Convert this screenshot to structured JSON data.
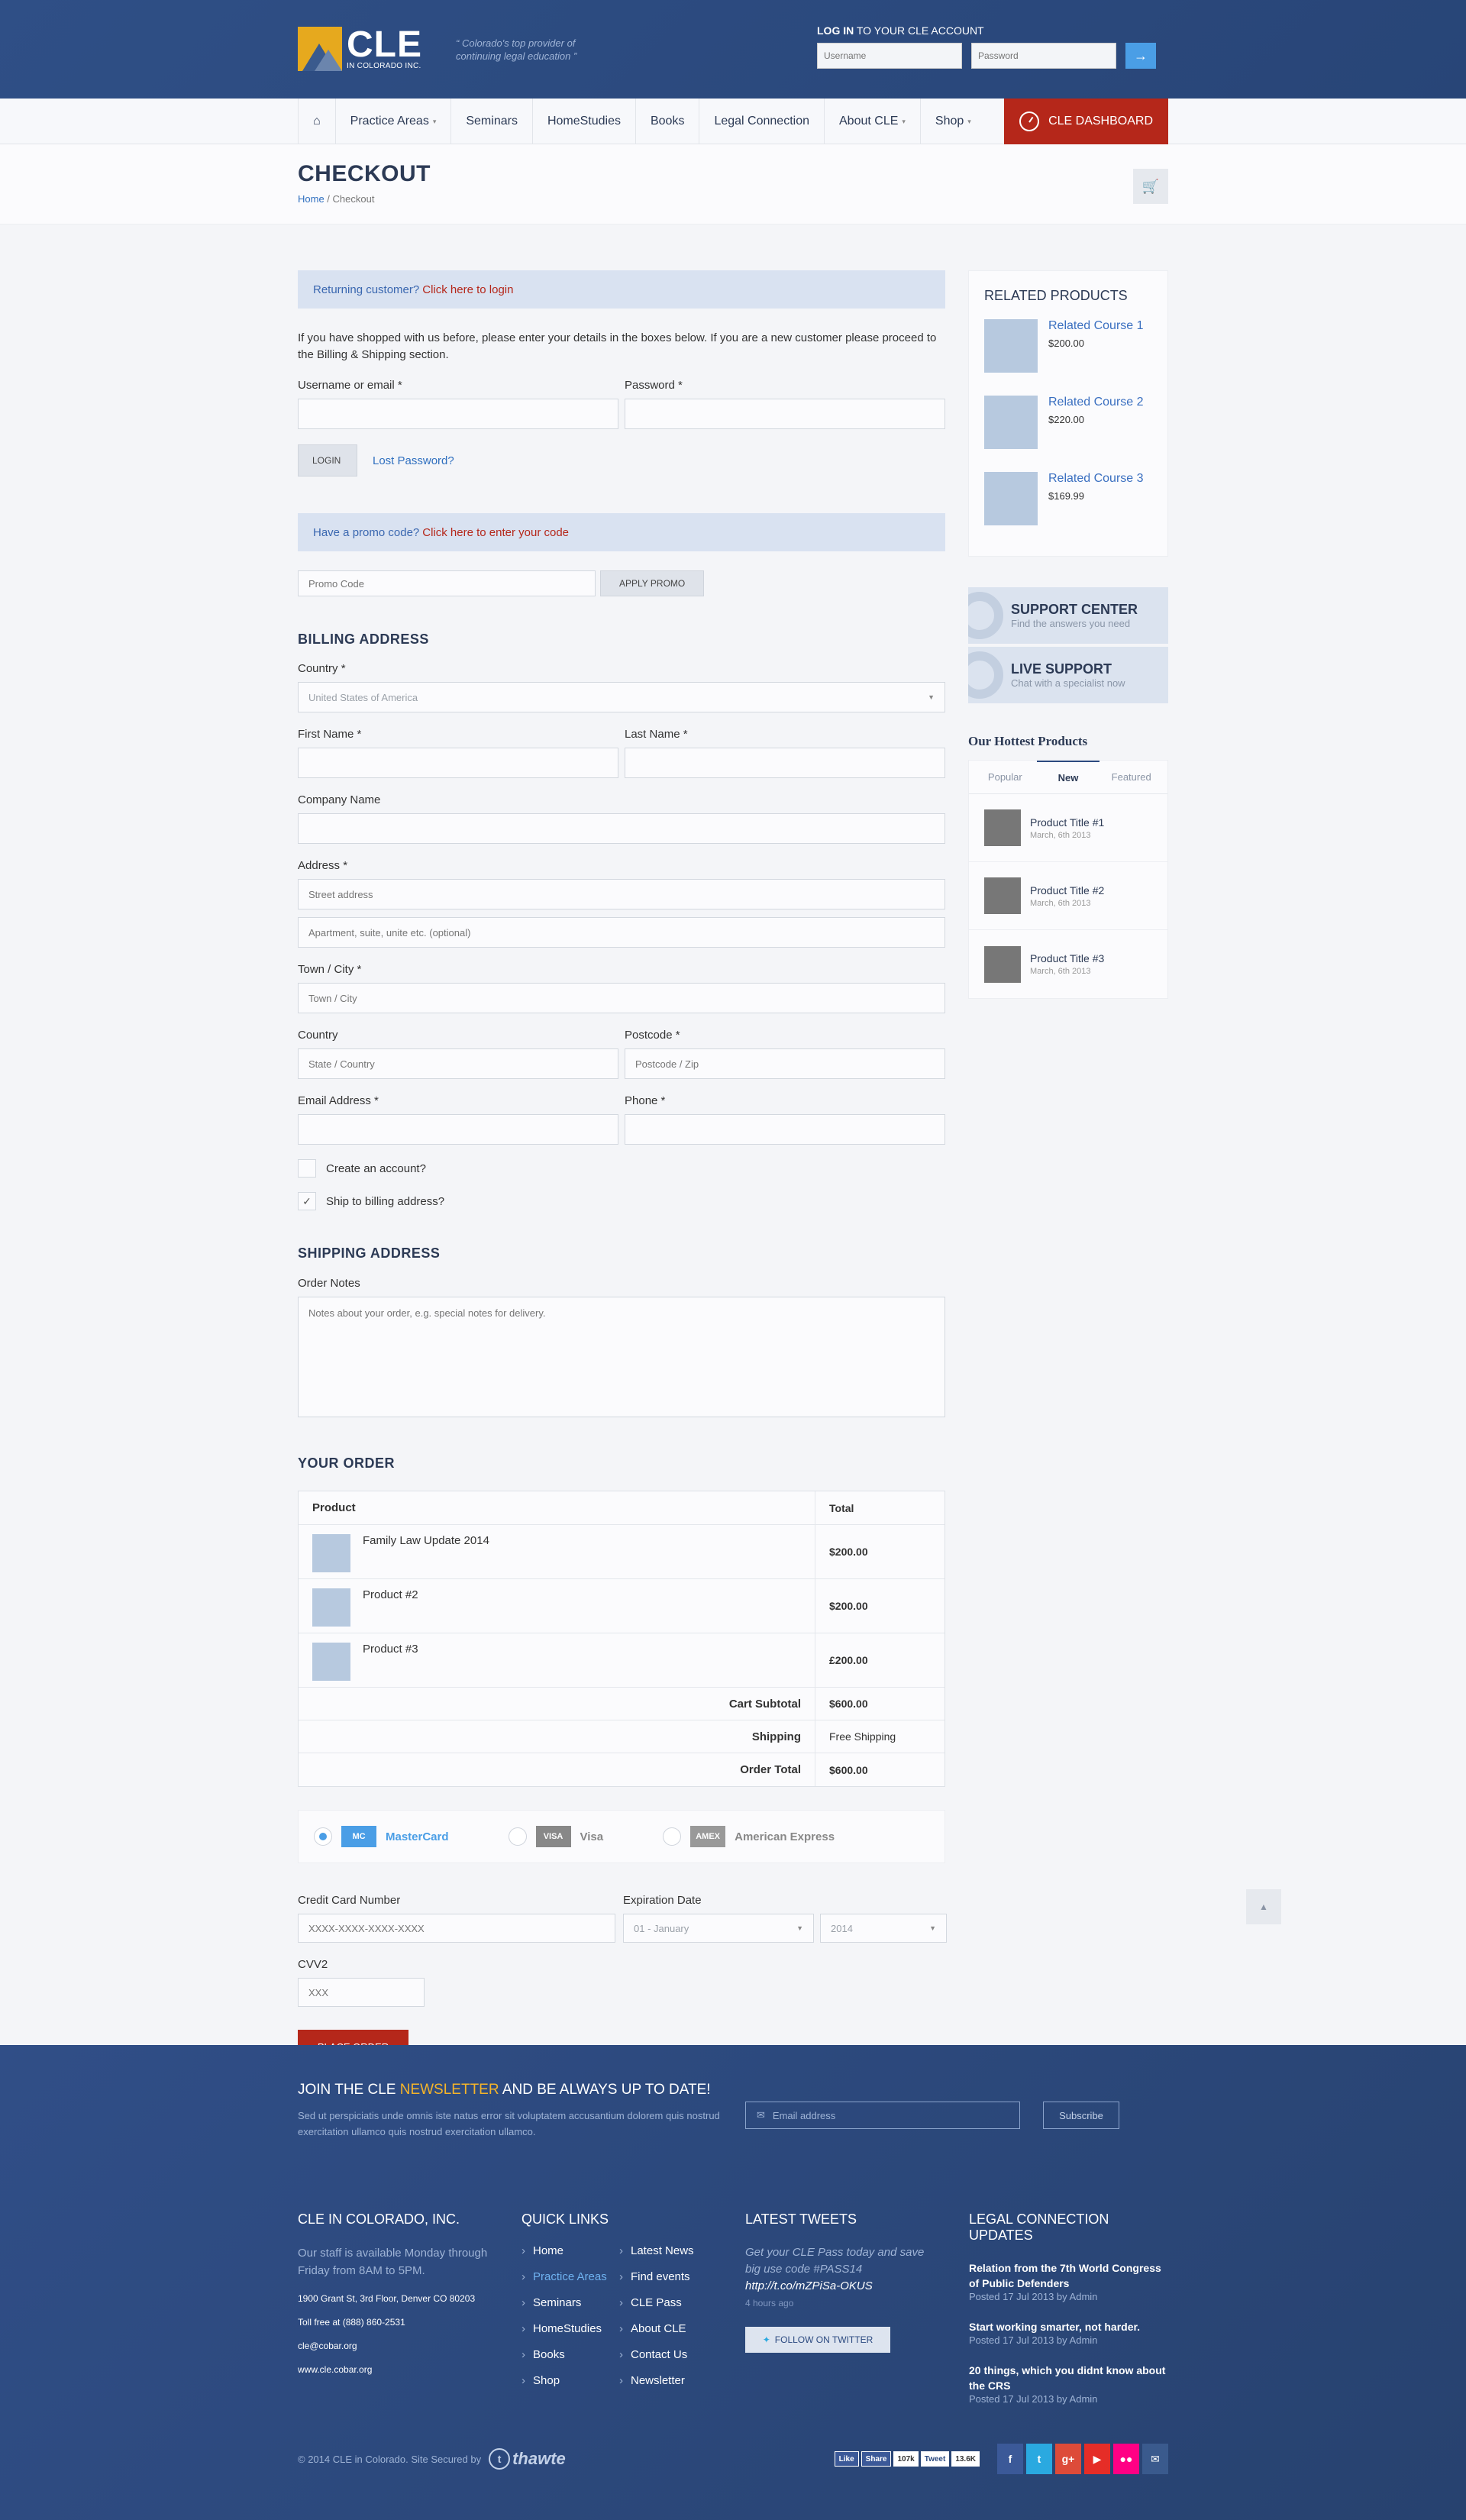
{
  "header": {
    "logo_big": "CLE",
    "logo_small": "IN COLORADO INC.",
    "tagline": "Colorado's top provider of continuing legal education",
    "login_title_bold": "LOG IN",
    "login_title_rest": "TO YOUR CLE ACCOUNT",
    "username_placeholder": "Username",
    "password_placeholder": "Password",
    "go_icon": "→"
  },
  "nav": {
    "home_icon": "⌂",
    "items": [
      {
        "label": "Practice Areas",
        "caret": "▾"
      },
      {
        "label": "Seminars",
        "caret": ""
      },
      {
        "label": "HomeStudies",
        "caret": ""
      },
      {
        "label": "Books",
        "caret": ""
      },
      {
        "label": "Legal Connection",
        "caret": ""
      },
      {
        "label": "About CLE",
        "caret": "▾"
      },
      {
        "label": "Shop",
        "caret": "▾"
      }
    ],
    "dashboard": "CLE DASHBOARD"
  },
  "pagehead": {
    "title": "CHECKOUT",
    "crumb_home": "Home",
    "crumb_sep": " / ",
    "crumb_current": "Checkout"
  },
  "checkout": {
    "returning_text": "Returning customer?",
    "returning_link": "Click here to login",
    "intro": "If you have shopped with us before, please enter your details in the boxes below. If you are a new customer please proceed to the Billing & Shipping section.",
    "username_label": "Username or email *",
    "password_label": "Password *",
    "login_button": "LOGIN",
    "lost_password": "Lost Password?",
    "promo_text": "Have a promo code?",
    "promo_link": "Click here to enter your code",
    "promo_placeholder": "Promo Code",
    "apply_promo": "APPLY PROMO"
  },
  "billing": {
    "title": "BILLING ADDRESS",
    "country_label": "Country *",
    "country_value": "United States of America",
    "first_name_label": "First Name *",
    "last_name_label": "Last Name *",
    "company_label": "Company Name",
    "address_label": "Address *",
    "street_placeholder": "Street address",
    "apt_placeholder": "Apartment, suite, unite etc. (optional)",
    "city_label": "Town / City *",
    "city_placeholder": "Town / City",
    "state_label": "Country",
    "state_placeholder": "State / Country",
    "postcode_label": "Postcode *",
    "postcode_placeholder": "Postcode / Zip",
    "email_label": "Email Address *",
    "phone_label": "Phone *",
    "create_account": "Create an account?",
    "ship_billing": "Ship to billing address?",
    "check_mark": "✓"
  },
  "shipping": {
    "title": "SHIPPING ADDRESS",
    "notes_label": "Order Notes",
    "notes_placeholder": "Notes about your order, e.g. special notes for delivery."
  },
  "order": {
    "title": "YOUR ORDER",
    "col_product": "Product",
    "col_total": "Total",
    "items": [
      {
        "name": "Family Law Update 2014",
        "total": "$200.00"
      },
      {
        "name": "Product #2",
        "total": "$200.00"
      },
      {
        "name": "Product #3",
        "total": "£200.00"
      }
    ],
    "subtotal_label": "Cart Subtotal",
    "subtotal_value": "$600.00",
    "shipping_label": "Shipping",
    "shipping_value": "Free Shipping",
    "total_label": "Order Total",
    "total_value": "$600.00"
  },
  "payment": {
    "options": [
      {
        "label": "MasterCard",
        "logo": "MC",
        "color": "#4a9ee6"
      },
      {
        "label": "Visa",
        "logo": "VISA",
        "color": "#888888"
      },
      {
        "label": "American Express",
        "logo": "AMEX",
        "color": "#999999"
      }
    ],
    "card_number_label": "Credit Card Number",
    "card_number_placeholder": "XXXX-XXXX-XXXX-XXXX",
    "expiry_label": "Expiration Date",
    "expiry_month": "01 - January",
    "expiry_year": "2014",
    "cvv_label": "CVV2",
    "cvv_placeholder": "XXX",
    "place_order": "PLACE ORDER"
  },
  "sidebar": {
    "related_title": "RELATED PRODUCTS",
    "related": [
      {
        "name": "Related Course 1",
        "price": "$200.00"
      },
      {
        "name": "Related Course 2",
        "price": "$220.00"
      },
      {
        "name": "Related Course 3",
        "price": "$169.99"
      }
    ],
    "support_title": "SUPPORT CENTER",
    "support_sub": "Find the answers you need",
    "live_title": "LIVE SUPPORT",
    "live_sub": "Chat with a specialist now",
    "hot_title": "Our Hottest Products",
    "tabs": [
      "Popular",
      "New",
      "Featured"
    ],
    "hot": [
      {
        "name": "Product Title #1",
        "date": "March, 6th 2013"
      },
      {
        "name": "Product Title #2",
        "date": "March, 6th 2013"
      },
      {
        "name": "Product Title #3",
        "date": "March, 6th 2013"
      }
    ]
  },
  "footer": {
    "nl_pre": "JOIN THE CLE ",
    "nl_hl": "NEWSLETTER",
    "nl_post": " AND BE ALWAYS UP TO DATE!",
    "nl_text": "Sed ut perspiciatis unde omnis iste natus error sit voluptatem accusantium dolorem  quis nostrud exercitation ullamco  quis nostrud exercitation ullamco.",
    "nl_placeholder": "Email address",
    "nl_button": "Subscribe",
    "about_title": "CLE IN COLORADO, INC.",
    "about_text": "Our staff is available Monday through Friday from 8AM to 5PM.",
    "address": "1900 Grant St, 3rd Floor, Denver CO 80203",
    "tollfree": "Toll free at (888) 860-2531",
    "email": "cle@cobar.org",
    "web": "www.cle.cobar.org",
    "links_title": "QUICK LINKS",
    "links_col1": [
      "Home",
      "Practice Areas",
      "Seminars",
      "HomeStudies",
      "Books",
      "Shop"
    ],
    "links_col2": [
      "Latest News",
      "Find events",
      "CLE Pass",
      "About CLE",
      "Contact Us",
      "Newsletter"
    ],
    "tweets_title": "LATEST TWEETS",
    "tweet_text": "Get your CLE Pass today and save big use code #PASS14",
    "tweet_url": "http://t.co/mZPiSa-OKUS",
    "tweet_time": "4 hours ago",
    "follow": "FOLLOW ON TWITTER",
    "updates_title": "LEGAL CONNECTION UPDATES",
    "updates": [
      {
        "title": "Relation from the 7th World Congress of Public Defenders",
        "date": "Posted 17 Jul 2013 by Admin"
      },
      {
        "title": "Start working smarter, not harder.",
        "date": "Posted 17 Jul 2013 by Admin"
      },
      {
        "title": "20 things, which you didnt know about the CRS",
        "date": "Posted 17 Jul 2013 by Admin"
      }
    ],
    "copyright": "© 2014 CLE in Colorado. Site Secured by",
    "thawte": "thawte",
    "fb_like": "Like",
    "fb_share": "Share",
    "fb_count": "107k",
    "tweet_btn": "Tweet",
    "tweet_count": "13.6K",
    "social": [
      {
        "icon": "f",
        "color": "#3b5998"
      },
      {
        "icon": "t",
        "color": "#2aa9e0"
      },
      {
        "icon": "g+",
        "color": "#dd4b39"
      },
      {
        "icon": "▶",
        "color": "#e52d27"
      },
      {
        "icon": "●●",
        "color": "#ff0084"
      },
      {
        "icon": "✉",
        "color": "#3a5a8d"
      }
    ]
  }
}
